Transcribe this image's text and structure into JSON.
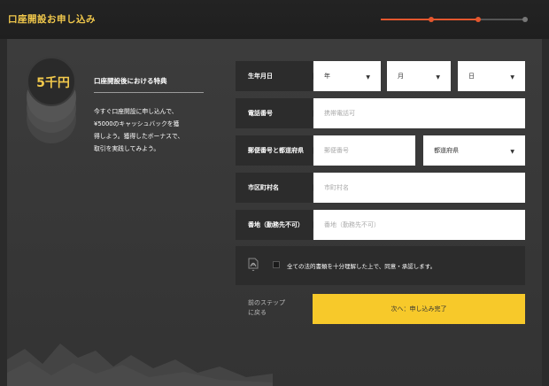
{
  "header": {
    "title": "口座開設お申し込み"
  },
  "bonus": {
    "coin_label": "5千円",
    "title": "口座開設後における特典",
    "lines": [
      "今すぐ口座開設に申し込んで、",
      "¥5000のキャッシュバックを獲",
      "得しよう。獲得したボーナスで、",
      "取引を実践してみよう。"
    ]
  },
  "form": {
    "birthdate": {
      "label": "生年月日",
      "year": "年",
      "month": "月",
      "day": "日"
    },
    "phone": {
      "label": "電話番号",
      "placeholder": "携帯電話可"
    },
    "postal": {
      "label": "郵便番号と都道府県",
      "placeholder": "郵便番号",
      "prefecture": "都道府県"
    },
    "city": {
      "label": "市区町村名",
      "placeholder": "市町村名"
    },
    "address": {
      "label": "番地（勤務先不可）",
      "placeholder": "番地（勤務先不可）"
    },
    "consent": "全ての法的書類を十分理解した上で、同意・承認します。",
    "back_label_line1": "前のステップ",
    "back_label_line2": "に戻る",
    "next_label": "次へ：申し込み完了"
  },
  "colors": {
    "accent": "#f2c94c",
    "button": "#f7c92a",
    "progress": "#e4572e"
  }
}
